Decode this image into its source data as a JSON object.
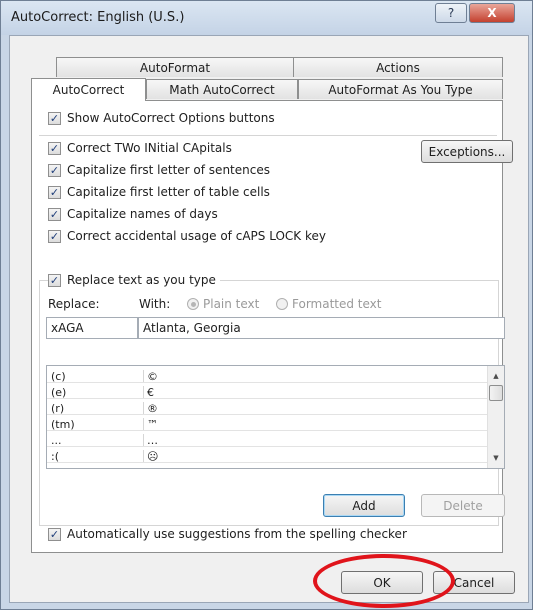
{
  "window": {
    "title": "AutoCorrect: English (U.S.)",
    "help_glyph": "?",
    "close_glyph": "X"
  },
  "tabs": {
    "back": [
      {
        "label": "AutoFormat"
      },
      {
        "label": "Actions"
      }
    ],
    "front": [
      {
        "label": "AutoCorrect",
        "active": true
      },
      {
        "label": "Math AutoCorrect",
        "active": false
      },
      {
        "label": "AutoFormat As You Type",
        "active": false
      }
    ]
  },
  "options": {
    "show_buttons": {
      "label": "Show AutoCorrect Options buttons",
      "checked": true
    },
    "items": [
      {
        "label": "Correct TWo INitial CApitals",
        "checked": true
      },
      {
        "label": "Capitalize first letter of sentences",
        "checked": true
      },
      {
        "label": "Capitalize first letter of table cells",
        "checked": true
      },
      {
        "label": "Capitalize names of days",
        "checked": true
      },
      {
        "label": "Correct accidental usage of cAPS LOCK key",
        "checked": true
      }
    ],
    "exceptions_label": "Exceptions..."
  },
  "replace_section": {
    "replace_as_you_type": {
      "label": "Replace text as you type",
      "checked": true
    },
    "replace_label": "Replace:",
    "with_label": "With:",
    "plain_text_label": "Plain text",
    "formatted_text_label": "Formatted text",
    "selected_format": "Plain text",
    "replace_value": "xAGA",
    "with_value": "Atlanta, Georgia",
    "entries": [
      {
        "replace": "(c)",
        "with": "©"
      },
      {
        "replace": "(e)",
        "with": "€"
      },
      {
        "replace": "(r)",
        "with": "®"
      },
      {
        "replace": "(tm)",
        "with": "™"
      },
      {
        "replace": "...",
        "with": "…"
      },
      {
        "replace": ":(",
        "with": "☹"
      }
    ],
    "add_label": "Add",
    "delete_label": "Delete",
    "spelling_suggestions": {
      "label": "Automatically use suggestions from the spelling checker",
      "checked": true
    }
  },
  "footer": {
    "ok_label": "OK",
    "cancel_label": "Cancel"
  },
  "colors": {
    "highlight_ring": "#e0141b",
    "title_bar": "#c4d3e6",
    "close_button": "#c4412f"
  }
}
